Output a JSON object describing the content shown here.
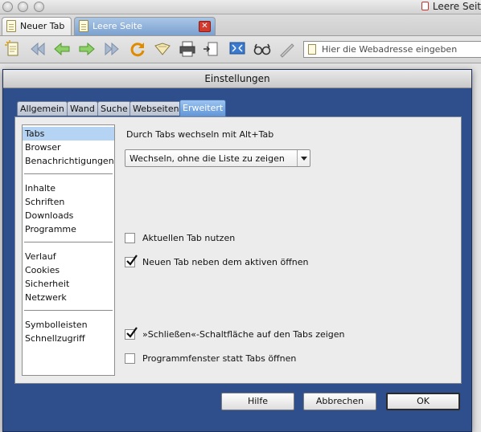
{
  "window": {
    "title": "Leere Seit"
  },
  "tabs": [
    {
      "label": "Neuer Tab",
      "active": false
    },
    {
      "label": "Leere Seite",
      "active": true,
      "close_icon": "close-x-icon"
    }
  ],
  "toolbar": {
    "icons": [
      "new-page-icon",
      "rewind-icon",
      "back-icon",
      "forward-icon",
      "fast-forward-icon",
      "reload-icon",
      "bookmark-icon",
      "print-icon",
      "page-arrow-icon",
      "fullscreen-icon",
      "glasses-icon",
      "pen-icon"
    ],
    "address_placeholder": "Hier die Webadresse eingeben"
  },
  "dialog": {
    "title": "Einstellungen",
    "tabs": [
      {
        "label": "Allgemein",
        "active": false
      },
      {
        "label": "Wand",
        "active": false
      },
      {
        "label": "Suche",
        "active": false
      },
      {
        "label": "Webseiten",
        "active": false
      },
      {
        "label": "Erweitert",
        "active": true
      }
    ],
    "categories": [
      {
        "group": [
          {
            "label": "Tabs",
            "selected": true
          },
          {
            "label": "Browser",
            "selected": false
          },
          {
            "label": "Benachrichtigungen",
            "selected": false
          }
        ]
      },
      {
        "group": [
          {
            "label": "Inhalte",
            "selected": false
          },
          {
            "label": "Schriften",
            "selected": false
          },
          {
            "label": "Downloads",
            "selected": false
          },
          {
            "label": "Programme",
            "selected": false
          }
        ]
      },
      {
        "group": [
          {
            "label": "Verlauf",
            "selected": false
          },
          {
            "label": "Cookies",
            "selected": false
          },
          {
            "label": "Sicherheit",
            "selected": false
          },
          {
            "label": "Netzwerk",
            "selected": false
          }
        ]
      },
      {
        "group": [
          {
            "label": "Symbolleisten",
            "selected": false
          },
          {
            "label": "Schnellzugriff",
            "selected": false
          }
        ]
      }
    ],
    "tab_cycle_label": "Durch Tabs wechseln mit Alt+Tab",
    "tab_cycle_value": "Wechseln, ohne die Liste zu zeigen",
    "options": [
      {
        "label": "Aktuellen Tab nutzen",
        "checked": false
      },
      {
        "label": "Neuen Tab neben dem aktiven öffnen",
        "checked": true
      },
      {
        "label": "»Schließen«-Schaltfläche auf den Tabs zeigen",
        "checked": true
      },
      {
        "label": "Programmfenster statt Tabs öffnen",
        "checked": false
      }
    ],
    "buttons": {
      "help": "Hilfe",
      "cancel": "Abbrechen",
      "ok": "OK"
    }
  },
  "colors": {
    "dialog_frame": "#2f4f8c",
    "active_tab": "#5f95d6",
    "selected_category": "#b5d3f3",
    "close_button": "#d23a2e"
  }
}
